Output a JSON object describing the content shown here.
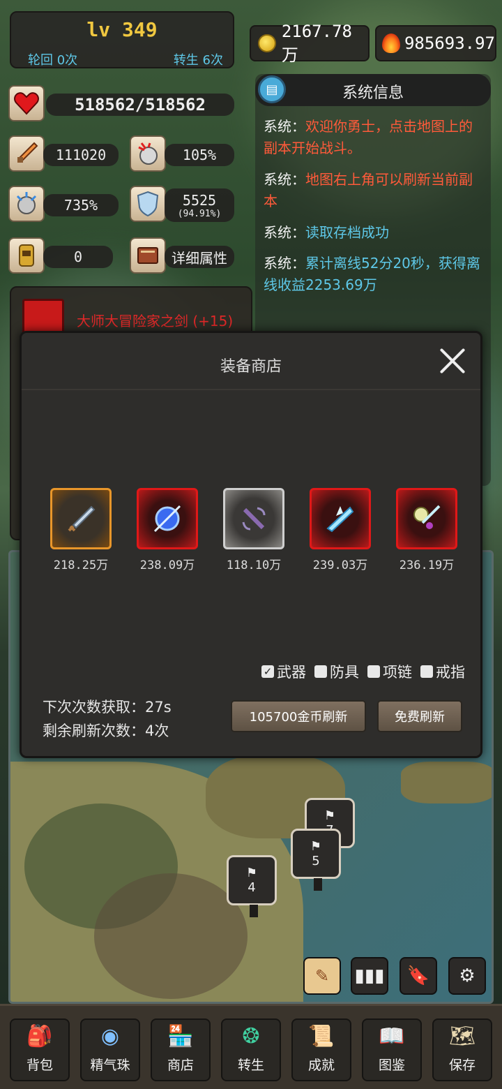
{
  "player": {
    "level": "lv 349",
    "reincarnation": "轮回 0次",
    "rebirth": "转生 6次"
  },
  "currency": {
    "gold": "2167.78万",
    "power": "985693.97"
  },
  "stats": {
    "hp": "518562/518562",
    "attack": "111020",
    "crit": "105%",
    "crit_damage": "735%",
    "defense": "5525",
    "defense_pct": "(94.91%)",
    "other": "0",
    "detail_label": "详细属性"
  },
  "system": {
    "title": "系统信息",
    "messages": [
      {
        "who": "系统：",
        "text": "欢迎你勇士，点击地图上的副本开始战斗。",
        "color": "red"
      },
      {
        "who": "系统：",
        "text": "地图右上角可以刷新当前副本",
        "color": "red"
      },
      {
        "who": "系统：",
        "text": "读取存档成功",
        "color": "cyan"
      },
      {
        "who": "系统：",
        "text": "累计离线52分20秒，获得离线收益2253.69万",
        "color": "cyan"
      }
    ]
  },
  "equipped": {
    "weapon_name": "大师大冒险家之剑 (+15)"
  },
  "shop": {
    "title": "装备商店",
    "items": [
      {
        "price": "218.25万",
        "rarity": "orange",
        "icon": "short-sword-icon"
      },
      {
        "price": "238.09万",
        "rarity": "red",
        "icon": "blue-orb-bow-icon"
      },
      {
        "price": "118.10万",
        "rarity": "white",
        "icon": "purple-dagger-icon"
      },
      {
        "price": "239.03万",
        "rarity": "red",
        "icon": "ice-crossbow-icon"
      },
      {
        "price": "236.19万",
        "rarity": "red",
        "icon": "jeweled-sword-icon"
      }
    ],
    "filters": [
      {
        "label": "武器",
        "checked": true
      },
      {
        "label": "防具",
        "checked": false
      },
      {
        "label": "项链",
        "checked": false
      },
      {
        "label": "戒指",
        "checked": false
      }
    ],
    "next_count": "下次次数获取：27s",
    "remaining": "剩余刷新次数：4次",
    "gold_refresh": "105700金币刷新",
    "free_refresh": "免费刷新"
  },
  "map": {
    "nodes": [
      "7",
      "5",
      "4"
    ]
  },
  "nav": [
    {
      "label": "背包",
      "icon": "backpack-icon"
    },
    {
      "label": "精气珠",
      "icon": "orb-icon"
    },
    {
      "label": "商店",
      "icon": "shop-icon"
    },
    {
      "label": "转生",
      "icon": "rebirth-icon"
    },
    {
      "label": "成就",
      "icon": "achievement-icon"
    },
    {
      "label": "图鉴",
      "icon": "codex-icon"
    },
    {
      "label": "保存",
      "icon": "save-icon"
    }
  ]
}
